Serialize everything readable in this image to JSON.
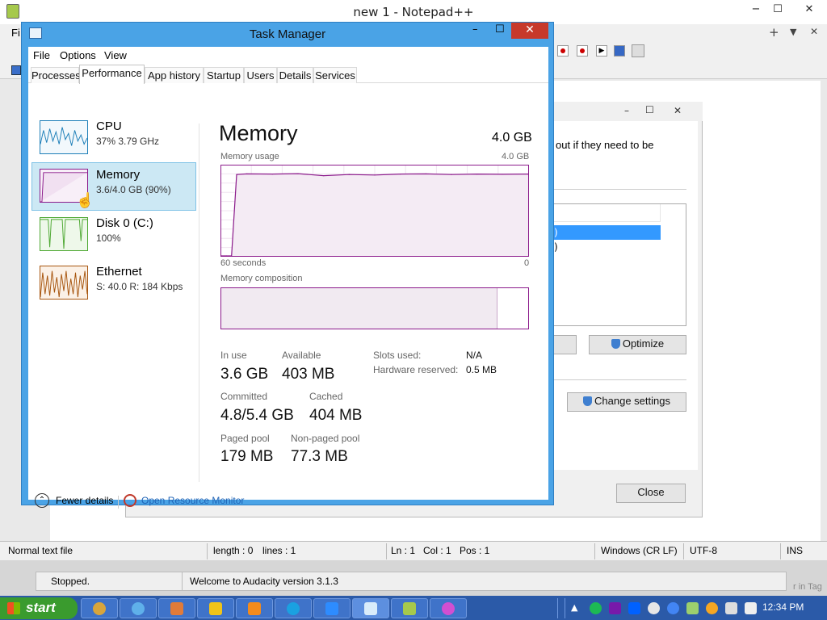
{
  "notepad": {
    "title": "new 1 - Notepad++",
    "minimize": "−",
    "maximize": "☐",
    "close": "✕",
    "menu_first": "Fi",
    "tab_plus": "+",
    "tab_dropdown": "▼",
    "tab_close": "✕",
    "status": {
      "file_type": "Normal text file",
      "length": "length : 0",
      "lines": "lines : 1",
      "ln": "Ln : 1",
      "col": "Col : 1",
      "pos": "Pos : 1",
      "eol": "Windows (CR LF)",
      "encoding": "UTF-8",
      "mode": "INS"
    }
  },
  "audacity": {
    "state": "Stopped.",
    "message": "Welcome to Audacity version 3.1.3",
    "side_text": "r in Tag"
  },
  "background_dialog": {
    "body_text_1": "out if they need to be",
    "item_1": ")",
    "item_2": ")",
    "optimize_label": "Optimize",
    "change_settings_label": "Change settings",
    "close_label": "Close",
    "min": "–",
    "max": "☐",
    "close_x": "✕"
  },
  "task_manager": {
    "title": "Task Manager",
    "controls": {
      "minimize": "–",
      "maximize": "☐",
      "close": "✕"
    },
    "menu": [
      "File",
      "Options",
      "View"
    ],
    "tabs": [
      "Processes",
      "Performance",
      "App history",
      "Startup",
      "Users",
      "Details",
      "Services"
    ],
    "active_tab": "Performance",
    "resources": [
      {
        "name": "CPU",
        "sub": "37%  3.79 GHz",
        "color": "#1e7fb8"
      },
      {
        "name": "Memory",
        "sub": "3.6/4.0 GB (90%)",
        "color": "#8b1a8b"
      },
      {
        "name": "Disk 0 (C:)",
        "sub": "100%",
        "color": "#4da832"
      },
      {
        "name": "Ethernet",
        "sub": "S: 40.0  R: 184 Kbps",
        "color": "#a7550e"
      }
    ],
    "memory_panel": {
      "heading": "Memory",
      "total": "4.0 GB",
      "usage_label": "Memory usage",
      "usage_max": "4.0 GB",
      "time_left": "60 seconds",
      "time_right": "0",
      "composition_label": "Memory composition",
      "in_use_label": "In use",
      "in_use": "3.6 GB",
      "available_label": "Available",
      "available": "403 MB",
      "committed_label": "Committed",
      "committed": "4.8/5.4 GB",
      "cached_label": "Cached",
      "cached": "404 MB",
      "paged_label": "Paged pool",
      "paged": "179 MB",
      "nonpaged_label": "Non-paged pool",
      "nonpaged": "77.3 MB",
      "slots_label": "Slots used:",
      "slots": "N/A",
      "hw_label": "Hardware reserved:",
      "hw": "0.5 MB",
      "composition_in_use_fraction": 0.9
    },
    "fewer_details": "Fewer details",
    "open_resource_monitor": "Open Resource Monitor"
  },
  "chart_data": {
    "type": "area",
    "title": "Memory usage",
    "x_range": [
      60,
      0
    ],
    "ylim": [
      0,
      4.0
    ],
    "x": [
      60,
      59,
      58,
      57,
      55,
      50,
      45,
      40,
      35,
      30,
      25,
      20,
      15,
      10,
      5,
      0
    ],
    "values": [
      0,
      0,
      0,
      3.6,
      3.63,
      3.62,
      3.64,
      3.55,
      3.6,
      3.58,
      3.62,
      3.63,
      3.6,
      3.62,
      3.61,
      3.62
    ]
  },
  "taskbar": {
    "start_label": "start",
    "clock": "12:34 PM"
  }
}
